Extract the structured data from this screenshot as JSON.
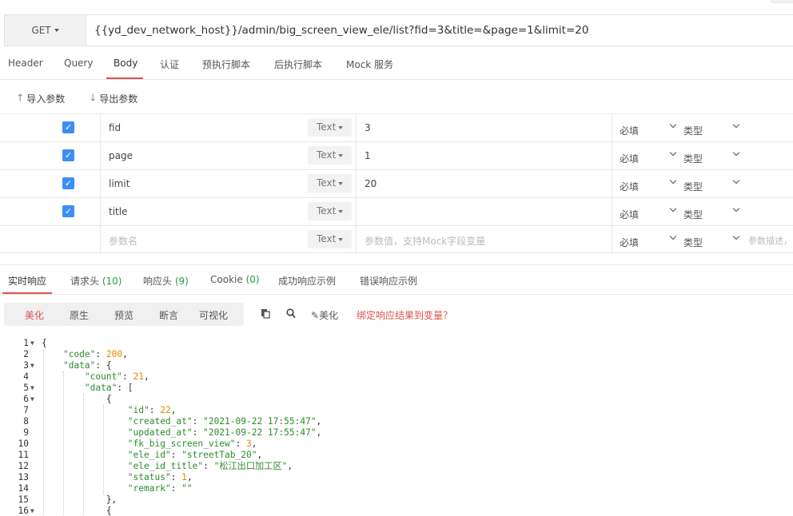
{
  "request": {
    "method": "GET",
    "url": "{{yd_dev_network_host}}/admin/big_screen_view_ele/list?fid=3&title=&page=1&limit=20"
  },
  "request_tabs": [
    "Header",
    "Query",
    "Body",
    "认证",
    "预执行脚本",
    "后执行脚本",
    "Mock 服务"
  ],
  "request_active_tab": "Body",
  "body_toolbar": {
    "import_label": "导入参数",
    "export_label": "导出参数"
  },
  "params": [
    {
      "checked": true,
      "name": "fid",
      "type": "Text",
      "value": "3",
      "required": "必填",
      "type_label": "类型"
    },
    {
      "checked": true,
      "name": "page",
      "type": "Text",
      "value": "1",
      "required": "必填",
      "type_label": "类型"
    },
    {
      "checked": true,
      "name": "limit",
      "type": "Text",
      "value": "20",
      "required": "必填",
      "type_label": "类型"
    },
    {
      "checked": true,
      "name": "title",
      "type": "Text",
      "value": "",
      "required": "必填",
      "type_label": "类型"
    }
  ],
  "new_param": {
    "name_placeholder": "参数名",
    "type": "Text",
    "value_placeholder": "参数值，支持Mock字段变量",
    "required": "必填",
    "type_label": "类型",
    "desc_placeholder": "参数描述，"
  },
  "response_tabs": [
    {
      "label": "实时响应",
      "count": ""
    },
    {
      "label": "请求头",
      "count": "(10)"
    },
    {
      "label": "响应头",
      "count": "(9)"
    },
    {
      "label": "Cookie",
      "count": "(0)"
    },
    {
      "label": "成功响应示例",
      "count": ""
    },
    {
      "label": "错误响应示例",
      "count": ""
    }
  ],
  "view_modes": [
    "美化",
    "原生",
    "预览",
    "断言",
    "可视化"
  ],
  "active_view_mode": "美化",
  "toolbar": {
    "beautify_label": "美化",
    "bind_link": "绑定响应结果到变量？"
  },
  "colors": {
    "accent": "#d9534f",
    "checkbox": "#3d8ef4",
    "json_key": "#2e8b2e",
    "json_number": "#e08a00",
    "count": "#2e9a4c"
  },
  "code_lines": [
    {
      "n": "1",
      "fold": true,
      "tokens": [
        [
          "p",
          "{"
        ]
      ]
    },
    {
      "n": "2",
      "fold": false,
      "tokens": [
        [
          "p",
          "    "
        ],
        [
          "k",
          "\"code\""
        ],
        [
          "p",
          ": "
        ],
        [
          "n",
          "200"
        ],
        [
          "p",
          ","
        ]
      ]
    },
    {
      "n": "3",
      "fold": true,
      "tokens": [
        [
          "p",
          "    "
        ],
        [
          "k",
          "\"data\""
        ],
        [
          "p",
          ": {"
        ]
      ]
    },
    {
      "n": "4",
      "fold": false,
      "tokens": [
        [
          "p",
          "        "
        ],
        [
          "k",
          "\"count\""
        ],
        [
          "p",
          ": "
        ],
        [
          "n",
          "21"
        ],
        [
          "p",
          ","
        ]
      ]
    },
    {
      "n": "5",
      "fold": true,
      "tokens": [
        [
          "p",
          "        "
        ],
        [
          "k",
          "\"data\""
        ],
        [
          "p",
          ": ["
        ]
      ]
    },
    {
      "n": "6",
      "fold": true,
      "tokens": [
        [
          "p",
          "            {"
        ]
      ]
    },
    {
      "n": "7",
      "fold": false,
      "tokens": [
        [
          "p",
          "                "
        ],
        [
          "k",
          "\"id\""
        ],
        [
          "p",
          ": "
        ],
        [
          "n",
          "22"
        ],
        [
          "p",
          ","
        ]
      ]
    },
    {
      "n": "8",
      "fold": false,
      "tokens": [
        [
          "p",
          "                "
        ],
        [
          "k",
          "\"created_at\""
        ],
        [
          "p",
          ": "
        ],
        [
          "s",
          "\"2021-09-22 17:55:47\""
        ],
        [
          "p",
          ","
        ]
      ]
    },
    {
      "n": "9",
      "fold": false,
      "tokens": [
        [
          "p",
          "                "
        ],
        [
          "k",
          "\"updated_at\""
        ],
        [
          "p",
          ": "
        ],
        [
          "s",
          "\"2021-09-22 17:55:47\""
        ],
        [
          "p",
          ","
        ]
      ]
    },
    {
      "n": "10",
      "fold": false,
      "tokens": [
        [
          "p",
          "                "
        ],
        [
          "k",
          "\"fk_big_screen_view\""
        ],
        [
          "p",
          ": "
        ],
        [
          "n",
          "3"
        ],
        [
          "p",
          ","
        ]
      ]
    },
    {
      "n": "11",
      "fold": false,
      "tokens": [
        [
          "p",
          "                "
        ],
        [
          "k",
          "\"ele_id\""
        ],
        [
          "p",
          ": "
        ],
        [
          "s",
          "\"streetTab_20\""
        ],
        [
          "p",
          ","
        ]
      ]
    },
    {
      "n": "12",
      "fold": false,
      "tokens": [
        [
          "p",
          "                "
        ],
        [
          "k",
          "\"ele_id_title\""
        ],
        [
          "p",
          ": "
        ],
        [
          "s",
          "\"松江出口加工区\""
        ],
        [
          "p",
          ","
        ]
      ]
    },
    {
      "n": "13",
      "fold": false,
      "tokens": [
        [
          "p",
          "                "
        ],
        [
          "k",
          "\"status\""
        ],
        [
          "p",
          ": "
        ],
        [
          "n",
          "1"
        ],
        [
          "p",
          ","
        ]
      ]
    },
    {
      "n": "14",
      "fold": false,
      "tokens": [
        [
          "p",
          "                "
        ],
        [
          "k",
          "\"remark\""
        ],
        [
          "p",
          ": "
        ],
        [
          "s",
          "\"\""
        ]
      ]
    },
    {
      "n": "15",
      "fold": false,
      "tokens": [
        [
          "p",
          "            },"
        ]
      ]
    },
    {
      "n": "16",
      "fold": true,
      "tokens": [
        [
          "p",
          "            {"
        ]
      ]
    }
  ]
}
